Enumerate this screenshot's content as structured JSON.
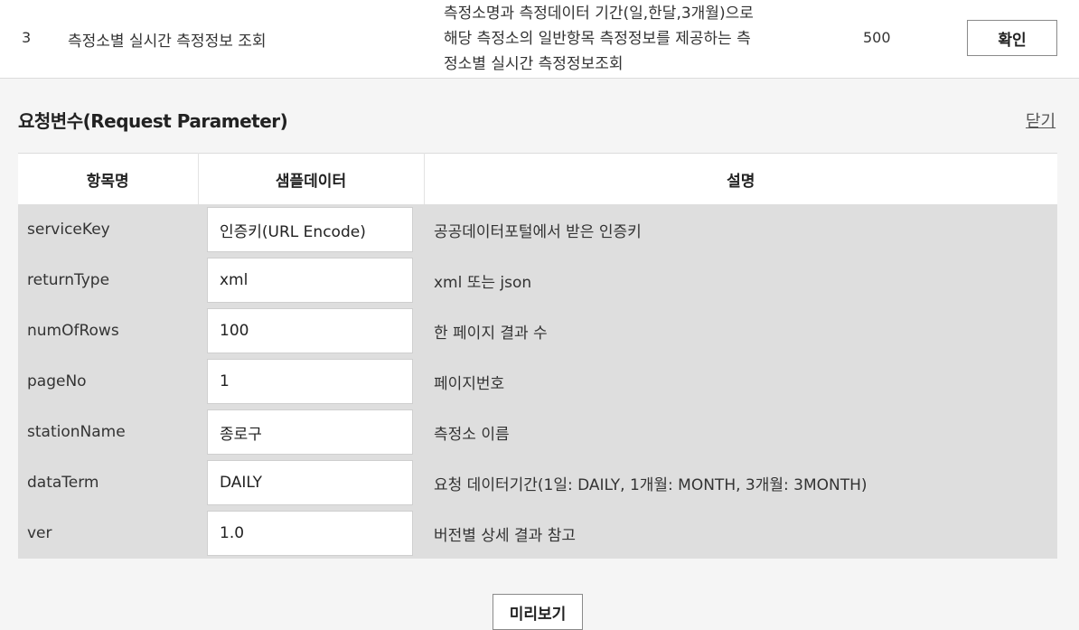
{
  "operation_row": {
    "number": "3",
    "name": "측정소별 실시간 측정정보 조회",
    "description_lines": [
      "측정소명과 측정데이터 기간(일,한달,3개월)으로",
      "해당 측정소의 일반항목 측정정보를 제공하는 측",
      "정소별 실시간 측정정보조회"
    ],
    "count": "500",
    "confirm_label": "확인"
  },
  "request_section": {
    "title": "요청변수(Request Parameter)",
    "close_label": "닫기"
  },
  "table": {
    "headers": [
      "항목명",
      "샘플데이터",
      "설명"
    ],
    "rows": [
      {
        "name": "serviceKey",
        "sample": "인증키(URL Encode)",
        "desc": "공공데이터포털에서 받은 인증키"
      },
      {
        "name": "returnType",
        "sample": "xml",
        "desc": "xml 또는 json"
      },
      {
        "name": "numOfRows",
        "sample": "100",
        "desc": "한 페이지 결과 수"
      },
      {
        "name": "pageNo",
        "sample": "1",
        "desc": "페이지번호"
      },
      {
        "name": "stationName",
        "sample": "종로구",
        "desc": "측정소 이름"
      },
      {
        "name": "dataTerm",
        "sample": "DAILY",
        "desc": "요청 데이터기간(1일: DAILY, 1개월: MONTH, 3개월: 3MONTH)"
      },
      {
        "name": "ver",
        "sample": "1.0",
        "desc": "버전별 상세 결과 참고"
      }
    ]
  },
  "preview_label": "미리보기"
}
